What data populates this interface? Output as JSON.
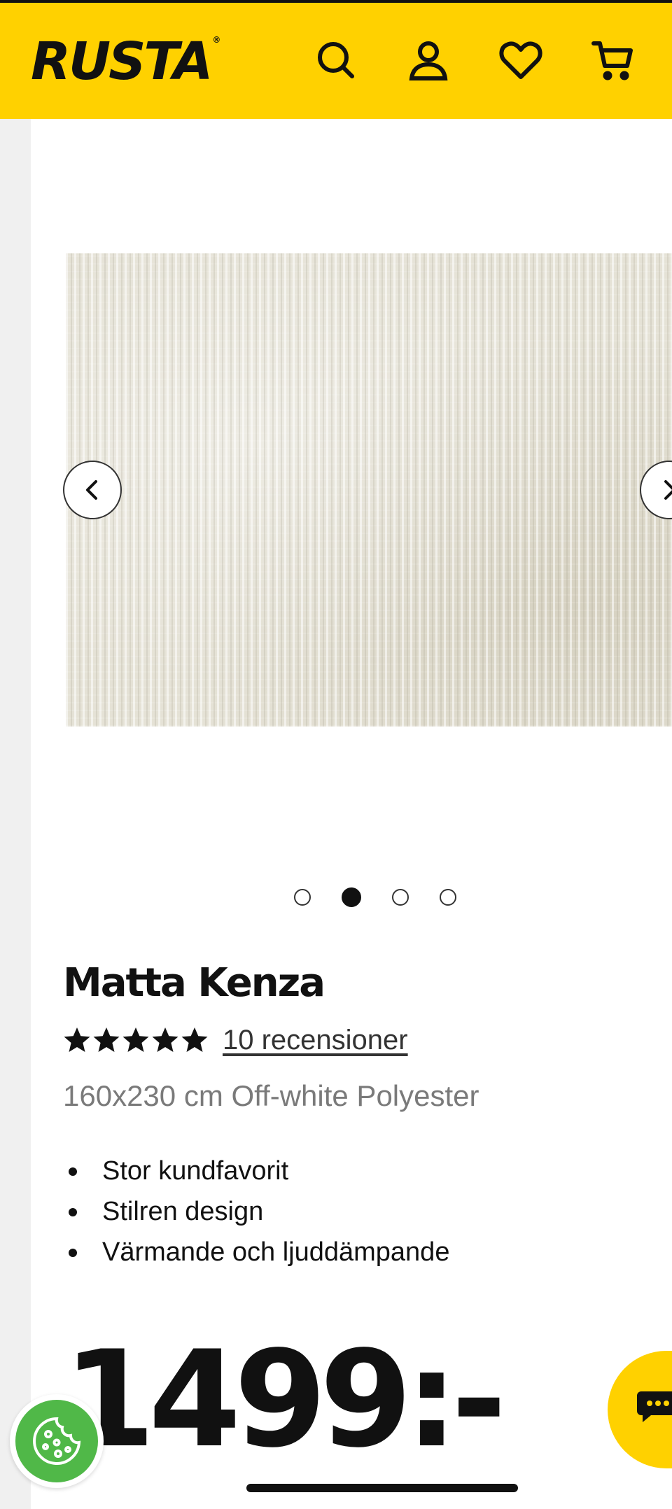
{
  "header": {
    "logo": "RUSTA",
    "logo_mark": "®",
    "icons": [
      "search-icon",
      "account-icon",
      "heart-icon",
      "cart-icon"
    ],
    "background_color": "#ffd100"
  },
  "carousel": {
    "total_slides": 4,
    "active_slide": 2,
    "prev_icon": "chevron-left-icon",
    "next_icon": "chevron-right-icon"
  },
  "product": {
    "title": "Matta Kenza",
    "rating": 5,
    "rating_max": 5,
    "reviews_label": "10 recensioner",
    "subtitle": "160x230 cm Off-white Polyester",
    "features": [
      "Stor kundfavorit",
      "Stilren design",
      "Värmande och ljuddämpande"
    ],
    "price": "1499:-"
  },
  "floating": {
    "cookie_icon": "cookie-icon",
    "chat_icon": "chat-icon",
    "cookie_color": "#50b848",
    "chat_color": "#ffd100"
  }
}
